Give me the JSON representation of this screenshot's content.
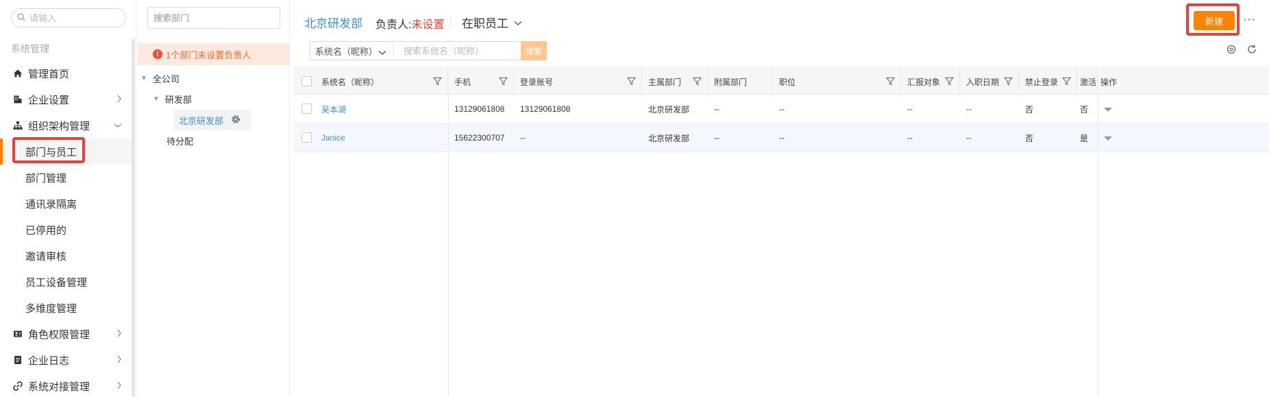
{
  "sidebar": {
    "search_placeholder": "请输入",
    "section_title": "系统管理",
    "items": [
      {
        "label": "管理首页",
        "icon": "home-icon"
      },
      {
        "label": "企业设置",
        "icon": "building-icon"
      },
      {
        "label": "组织架构管理",
        "icon": "org-chart-icon"
      },
      {
        "label": "部门与员工"
      },
      {
        "label": "部门管理"
      },
      {
        "label": "通讯录隔离"
      },
      {
        "label": "已停用的"
      },
      {
        "label": "邀请审核"
      },
      {
        "label": "员工设备管理"
      },
      {
        "label": "多维度管理"
      },
      {
        "label": "角色权限管理",
        "icon": "id-card-icon"
      },
      {
        "label": "企业日志",
        "icon": "log-icon"
      },
      {
        "label": "系统对接管理",
        "icon": "link-icon"
      }
    ]
  },
  "tree": {
    "search_placeholder": "搜索部门",
    "warning": "1个部门未设置负责人",
    "nodes": [
      "全公司",
      "研发部",
      "北京研发部",
      "待分配"
    ]
  },
  "header": {
    "title": "北京研发部",
    "owner_label": "负责人:",
    "owner_value": "未设置",
    "status": "在职员工",
    "new_button": "新建",
    "more": "···"
  },
  "filter": {
    "select_value": "系统名（昵称）",
    "search_placeholder": "搜索系统名（昵称）",
    "search_button": "搜索"
  },
  "table": {
    "columns": [
      "系统名（昵称）",
      "手机",
      "登录账号",
      "主属部门",
      "附属部门",
      "职位",
      "汇报对象",
      "入职日期",
      "禁止登录",
      "激活",
      "操作"
    ],
    "rows": [
      [
        "吴本湖",
        "13129061808",
        "13129061808",
        "北京研发部",
        "--",
        "--",
        "--",
        "--",
        "否",
        "否"
      ],
      [
        "Janice",
        "15622300707",
        "--",
        "北京研发部",
        "--",
        "--",
        "--",
        "--",
        "否",
        "是"
      ]
    ]
  },
  "colors": {
    "accent": "#ff8200",
    "link": "#3b8fd9",
    "danger": "#e8403a"
  }
}
